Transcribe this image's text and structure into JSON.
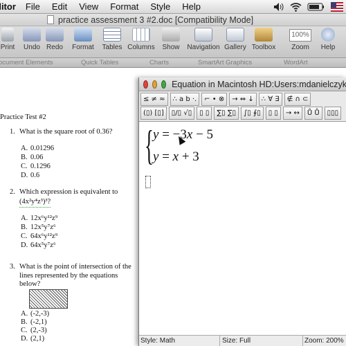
{
  "menubar": {
    "app": "ditor",
    "items": [
      "File",
      "Edit",
      "View",
      "Format",
      "Style",
      "Help"
    ],
    "status_icons": [
      "volume-icon",
      "wifi-icon",
      "battery-icon",
      "flag-icon"
    ]
  },
  "word": {
    "title": "practice assessment 3 #2.doc [Compatibility Mode]",
    "toolbar": [
      "Print",
      "Undo",
      "Redo",
      "Format",
      "Tables",
      "Columns",
      "Show",
      "Navigation",
      "Gallery",
      "Toolbox",
      "Zoom",
      "Help"
    ],
    "zoom": "100%",
    "ribbon": [
      "ocument Elements",
      "Quick Tables",
      "Charts",
      "SmartArt Graphics",
      "WordArt"
    ]
  },
  "document": {
    "heading": "Practice Test #2",
    "q1": {
      "num": "1.",
      "text": "What is the square root of 0.36?",
      "options": [
        [
          "A.",
          "0.01296"
        ],
        [
          "B.",
          "0.06"
        ],
        [
          "C.",
          "0.1296"
        ],
        [
          "D.",
          "0.6"
        ]
      ]
    },
    "q2": {
      "num": "2.",
      "text": "Which expression is equivalent to",
      "expr": "(4x²y⁴z³)³?",
      "options": [
        [
          "A.",
          "12x⁶y¹²z⁹"
        ],
        [
          "B.",
          "12x⁵y⁷z⁶"
        ],
        [
          "C.",
          "64x⁶y¹²z⁹"
        ],
        [
          "D.",
          "64x⁵y⁷z⁶"
        ]
      ]
    },
    "q3": {
      "num": "3.",
      "text": "What is the point of intersection of the lines represented by the equations below?",
      "options": [
        [
          "A.",
          "(-2,-3)"
        ],
        [
          "B.",
          "(-2,1)"
        ],
        [
          "C.",
          "(2,-3)"
        ],
        [
          "D.",
          "(2,1)"
        ]
      ]
    }
  },
  "equation_window": {
    "title": "Equation in Macintosh HD:Users:mdanielczyk",
    "palette_row1": [
      "≤ ≠ ≈",
      "∴ a b ·.",
      "⌐ • ⊗",
      "→ ⇔ ↓",
      "∴ ∀ ∃",
      "∉ ∩ ⊂"
    ],
    "palette_row2": [
      "(▯) [▯]",
      "▯/▯ √▯",
      "▯ ▯",
      "∑▯ ∑▯",
      "∫▯ ∮▯",
      "▯ ▯",
      "→ ↔",
      "Ů Ů",
      "▯▯▯"
    ],
    "line1": [
      "y",
      " = −3",
      "x",
      " − 5"
    ],
    "line2": [
      "y",
      " = ",
      "x",
      " + 3"
    ],
    "status": {
      "style": "Style: Math",
      "size": "Size: Full",
      "zoom": "Zoom: 200%"
    }
  },
  "colors": {
    "close": "#e0443e",
    "minimize": "#dea236",
    "zoom": "#3ea844"
  }
}
